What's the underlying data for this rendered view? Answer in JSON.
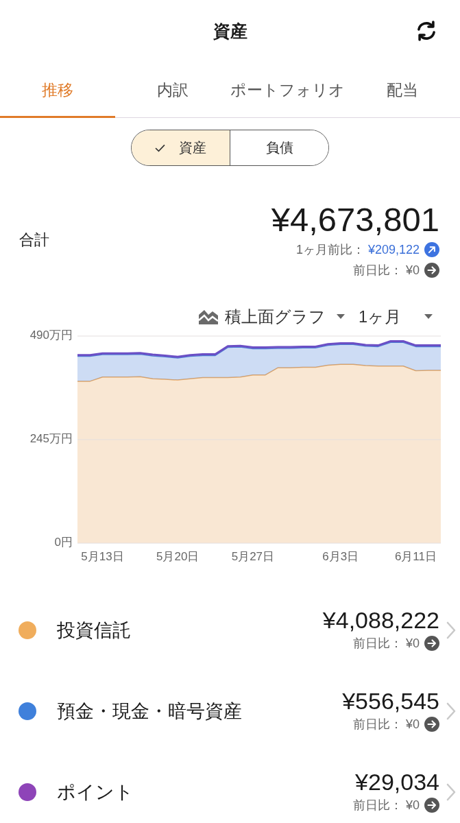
{
  "header": {
    "title": "資産"
  },
  "tabs": [
    {
      "label": "推移",
      "selected": true
    },
    {
      "label": "内訳",
      "selected": false
    },
    {
      "label": "ポートフォリオ",
      "selected": false
    },
    {
      "label": "配当",
      "selected": false
    }
  ],
  "segment": [
    {
      "label": "資産",
      "selected": true
    },
    {
      "label": "負債",
      "selected": false
    }
  ],
  "total": {
    "label": "合計",
    "amount": "¥4,673,801",
    "changes": [
      {
        "label": "1ヶ月前比：",
        "value": "¥209,122",
        "kind": "up"
      },
      {
        "label": "前日比：",
        "value": "¥0",
        "kind": "flat"
      }
    ]
  },
  "chart": {
    "type_selector": "積上面グラフ",
    "period_selector": "1ヶ月",
    "chart_data": {
      "type": "area",
      "stacked": true,
      "categories": [
        null,
        null,
        "5月13日",
        null,
        null,
        null,
        null,
        null,
        "5月20日",
        null,
        null,
        null,
        null,
        null,
        "5月27日",
        null,
        null,
        null,
        null,
        null,
        null,
        "6月3日",
        null,
        null,
        null,
        null,
        null,
        "6月11日",
        null,
        null
      ],
      "ylim": [
        0,
        490
      ],
      "yticks": [
        {
          "value": 0,
          "label": "0円"
        },
        {
          "value": 245,
          "label": "245万円"
        },
        {
          "value": 490,
          "label": "490万円"
        }
      ],
      "series": [
        {
          "color": "#e9a862",
          "values": [
            383,
            383,
            393,
            393,
            393,
            394,
            389,
            388,
            386,
            389,
            392,
            392,
            392,
            393,
            398,
            398,
            415,
            415,
            416,
            416,
            421,
            423,
            423,
            420,
            419,
            419,
            419,
            408,
            409,
            409
          ]
        },
        {
          "color": "#4a80d6",
          "values": [
            59,
            59,
            53,
            53,
            53,
            53,
            54,
            53,
            52,
            53,
            52,
            52,
            71,
            71,
            62,
            62,
            46,
            46,
            46,
            46,
            47,
            47,
            47,
            46,
            46,
            56,
            56,
            57,
            56,
            56
          ]
        },
        {
          "color": "#6b4fc5",
          "values": [
            3,
            3,
            3,
            3,
            3,
            3,
            3,
            3,
            3,
            3,
            3,
            3,
            3,
            3,
            3,
            3,
            3,
            3,
            3,
            3,
            3,
            3,
            3,
            3,
            3,
            3,
            3,
            3,
            3,
            3
          ]
        }
      ]
    }
  },
  "assets": [
    {
      "name": "投資信託",
      "color": "#f0ad5c",
      "amount": "¥4,088,222",
      "change": {
        "label": "前日比：",
        "value": "¥0",
        "kind": "flat"
      }
    },
    {
      "name": "預金・現金・暗号資産",
      "color": "#3f80db",
      "amount": "¥556,545",
      "change": {
        "label": "前日比：",
        "value": "¥0",
        "kind": "flat"
      }
    },
    {
      "name": "ポイント",
      "color": "#8e44b8",
      "amount": "¥29,034",
      "change": {
        "label": "前日比：",
        "value": "¥0",
        "kind": "flat"
      }
    }
  ]
}
